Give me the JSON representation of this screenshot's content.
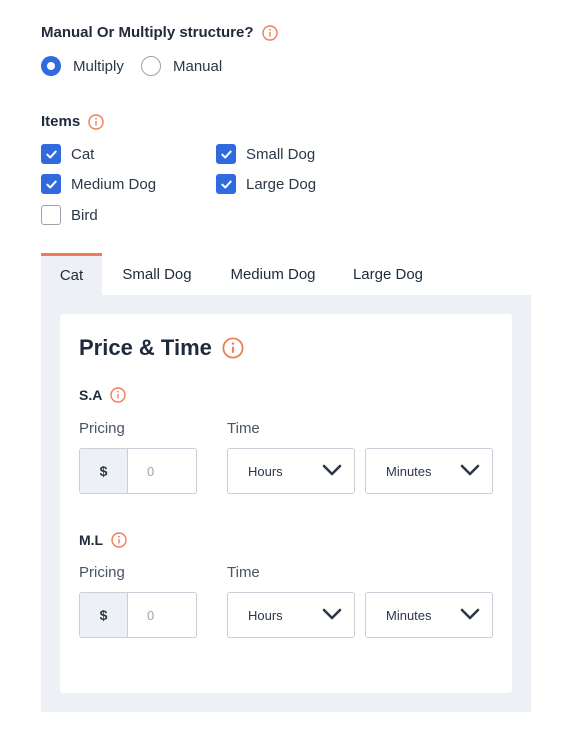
{
  "structure": {
    "label": "Manual Or Multiply structure?",
    "options": [
      {
        "label": "Multiply",
        "checked": true
      },
      {
        "label": "Manual",
        "checked": false
      }
    ]
  },
  "items": {
    "label": "Items",
    "options": [
      {
        "label": "Cat",
        "checked": true
      },
      {
        "label": "Small Dog",
        "checked": true
      },
      {
        "label": "Medium Dog",
        "checked": true
      },
      {
        "label": "Large Dog",
        "checked": true
      },
      {
        "label": "Bird",
        "checked": false
      }
    ]
  },
  "tabs": [
    {
      "label": "Cat",
      "active": true
    },
    {
      "label": "Small Dog",
      "active": false
    },
    {
      "label": "Medium Dog",
      "active": false
    },
    {
      "label": "Large Dog",
      "active": false
    }
  ],
  "card": {
    "title": "Price & Time",
    "groups": [
      {
        "label": "S.A",
        "pricing_label": "Pricing",
        "time_label": "Time",
        "currency": "$",
        "price_placeholder": "0",
        "hours_label": "Hours",
        "minutes_label": "Minutes"
      },
      {
        "label": "M.L",
        "pricing_label": "Pricing",
        "time_label": "Time",
        "currency": "$",
        "price_placeholder": "0",
        "hours_label": "Hours",
        "minutes_label": "Minutes"
      }
    ]
  },
  "colors": {
    "accent_blue": "#2f6bde",
    "accent_orange": "#ef7d54",
    "panel_bg": "#edf1f5"
  }
}
